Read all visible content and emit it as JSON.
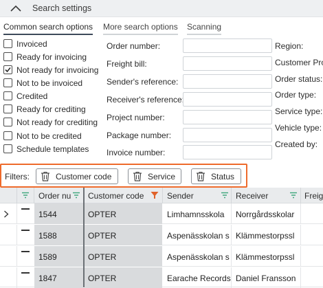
{
  "header": {
    "title": "Search settings",
    "collapse_icon": "chevron-up-icon"
  },
  "tabs": [
    {
      "label": "Common search options",
      "active": true
    },
    {
      "label": "More search options",
      "active": false
    },
    {
      "label": "Scanning",
      "active": false
    }
  ],
  "status_filters": [
    {
      "label": "Invoiced",
      "checked": false
    },
    {
      "label": "Ready for invoicing",
      "checked": false
    },
    {
      "label": "Not ready for invoicing",
      "checked": true
    },
    {
      "label": "Not to be invoiced",
      "checked": false
    },
    {
      "label": "Credited",
      "checked": false
    },
    {
      "label": "Ready for crediting",
      "checked": false
    },
    {
      "label": "Not ready for crediting",
      "checked": false
    },
    {
      "label": "Not to be credited",
      "checked": false
    },
    {
      "label": "Schedule templates",
      "checked": false
    }
  ],
  "fields": [
    {
      "label": "Order number:",
      "value": ""
    },
    {
      "label": "Freight bill:",
      "value": ""
    },
    {
      "label": "Sender's reference:",
      "value": ""
    },
    {
      "label": "Receiver's reference:",
      "value": ""
    },
    {
      "label": "Project number:",
      "value": ""
    },
    {
      "label": "Package number:",
      "value": ""
    },
    {
      "label": "Invoice number:",
      "value": ""
    }
  ],
  "right_fields": [
    {
      "label": "Region:"
    },
    {
      "label": "Customer Pro"
    },
    {
      "label": "Order status:"
    },
    {
      "label": "Order type:"
    },
    {
      "label": "Service type:"
    },
    {
      "label": "Vehicle type:"
    },
    {
      "label": "Created by:"
    }
  ],
  "filters": {
    "label": "Filters:",
    "chips": [
      {
        "label": "Customer code",
        "icon": "trash-icon"
      },
      {
        "label": "Service",
        "icon": "trash-icon"
      },
      {
        "label": "Status",
        "icon": "trash-icon"
      }
    ],
    "highlight_color": "#ee6a2b"
  },
  "grid": {
    "columns": [
      "",
      "",
      "Order nu",
      "Customer code",
      "Sender",
      "Receiver",
      "Freig"
    ],
    "rows": [
      {
        "order": "1544",
        "customer": "OPTER",
        "sender": "Limhamnsskola",
        "receiver": "Norrgårdsskolar",
        "current": true
      },
      {
        "order": "1588",
        "customer": "OPTER",
        "sender": "Aspenässkolan s",
        "receiver": "Klämmestorpssl",
        "current": false
      },
      {
        "order": "1589",
        "customer": "OPTER",
        "sender": "Aspenässkolan s",
        "receiver": "Klämmestorpssl",
        "current": false
      },
      {
        "order": "1847",
        "customer": "OPTER",
        "sender": "Earache Records",
        "receiver": "Daniel Fransson",
        "current": false
      }
    ],
    "filter_icon_color": "#3aa57a",
    "active_filter_icon_color": "#e0622a"
  }
}
